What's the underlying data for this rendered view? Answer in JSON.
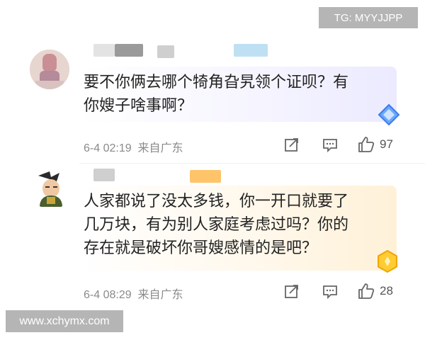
{
  "watermarks": {
    "top": "TG: MYYJJPP",
    "bottom": "www.xchymx.com"
  },
  "comments": [
    {
      "text": "要不你俩去哪个犄角旮旯领个证呗？有\n你嫂子啥事啊？",
      "time": "6-4 02:19",
      "location": "来自广东",
      "likes": "97",
      "bubble_color": "#ebeaff",
      "badge_icon": "blue-diamond-icon"
    },
    {
      "text": "人家都说了没太多钱，你一开口就要了\n几万块，有为别人家庭考虑过吗？你的\n存在就是破坏你哥嫂感情的是吧？",
      "time": "6-4 08:29",
      "location": "来自广东",
      "likes": "28",
      "bubble_color": "#fff1d8",
      "badge_icon": "gold-hexagon-icon"
    }
  ],
  "icons": {
    "share": "share-icon",
    "comment": "comment-icon",
    "like": "thumbs-up-icon"
  }
}
